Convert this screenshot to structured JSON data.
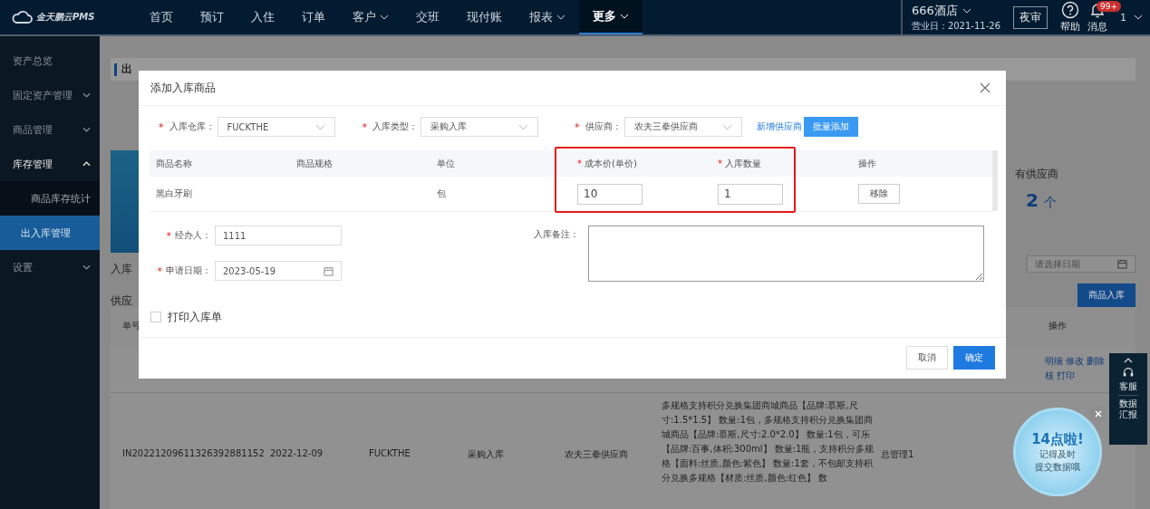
{
  "topbar": {
    "logo": "金天鹏云PMS",
    "nav": [
      {
        "label": "首页",
        "dropdown": false,
        "selected": false
      },
      {
        "label": "预订",
        "dropdown": false,
        "selected": false
      },
      {
        "label": "入住",
        "dropdown": false,
        "selected": false
      },
      {
        "label": "订单",
        "dropdown": false,
        "selected": false
      },
      {
        "label": "客户",
        "dropdown": true,
        "selected": false
      },
      {
        "label": "交班",
        "dropdown": false,
        "selected": false
      },
      {
        "label": "现付账",
        "dropdown": false,
        "selected": false
      },
      {
        "label": "报表",
        "dropdown": true,
        "selected": false
      },
      {
        "label": "更多",
        "dropdown": true,
        "selected": true
      }
    ],
    "hotel": "666酒店",
    "business_day": "营业日：2021-11-26",
    "night_audit": "夜审",
    "help": "帮助",
    "messages": "消息",
    "message_badge": "99+",
    "user": "1"
  },
  "sidebar": {
    "items": [
      {
        "label": "资产总览"
      },
      {
        "label": "固定资产管理",
        "expanded": false
      },
      {
        "label": "商品管理",
        "expanded": false
      },
      {
        "label": "库存管理",
        "expanded": true,
        "children": [
          {
            "label": "商品库存统计",
            "selected": false
          },
          {
            "label": "出入库管理",
            "selected": true
          }
        ]
      },
      {
        "label": "设置",
        "expanded": false
      }
    ]
  },
  "page": {
    "title": "出",
    "stat_label": "有供应商",
    "stat_value": "2",
    "stat_unit": "个",
    "filter_warehouse": "入库",
    "filter_supplier": "供应",
    "date_placeholder": "请选择日期",
    "add_button": "商品入库",
    "table": {
      "columns": [
        {
          "label": "单号"
        },
        {
          "label": "操作"
        }
      ],
      "rows": [
        {
          "actions": [
            "明细",
            "修改",
            "删除",
            "核",
            "打印"
          ]
        },
        {
          "number": "IN20221209611326392881152",
          "date": "2022-12-09",
          "warehouse": "FUCKTHE",
          "type": "采购入库",
          "supplier": "农夫三拳供应商",
          "items": "多规格支持积分兑换集团商城商品【品牌:慕斯,尺寸:1.5*1.5】 数量:1包，多规格支持积分兑换集团商城商品【品牌:慕斯,尺寸:2.0*2.0】 数量:1包，可乐【品牌:百事,体积:300ml】 数量:1瓶，支持积分多规格【面料:丝质,颜色:紫色】 数量:1套，不包邮支持积分兑换多规格【材质:丝质,颜色:红色】 数",
          "operator": "总管理1"
        }
      ]
    }
  },
  "float_panel": {
    "service": "客服",
    "report": "数据汇报"
  },
  "reminder": {
    "title": "14点啦!",
    "line1": "记得及时",
    "line2": "提交数据哦"
  },
  "dialog": {
    "title": "添加入库商品",
    "fields": [
      {
        "required": true,
        "label": "入库仓库：",
        "value": "FUCKTHE"
      },
      {
        "required": true,
        "label": "入库类型：",
        "value": "采购入库"
      },
      {
        "required": true,
        "label": "供应商：",
        "value": "农夫三拳供应商"
      }
    ],
    "required_mark": "*",
    "add_supplier_link": "新增供应商",
    "batch_add": "批量添加",
    "columns": [
      {
        "label": "商品名称",
        "required": false
      },
      {
        "label": "商品规格",
        "required": false
      },
      {
        "label": "单位",
        "required": false
      },
      {
        "label": "成本价(单价)",
        "required": true
      },
      {
        "label": "入库数量",
        "required": true
      },
      {
        "label": "操作",
        "required": false
      }
    ],
    "rows": [
      {
        "name": "黑白牙刷",
        "unit": "包",
        "cost": "10",
        "quantity": "1",
        "remove": "移除"
      }
    ],
    "operator": {
      "required": true,
      "label": "经办人：",
      "value": "1111"
    },
    "date": {
      "required": true,
      "label": "申请日期：",
      "value": "2023-05-19"
    },
    "remark": {
      "label": "入库备注："
    },
    "print": {
      "label": "打印入库单",
      "checked": false
    },
    "cancel": "取消",
    "confirm": "确定"
  }
}
